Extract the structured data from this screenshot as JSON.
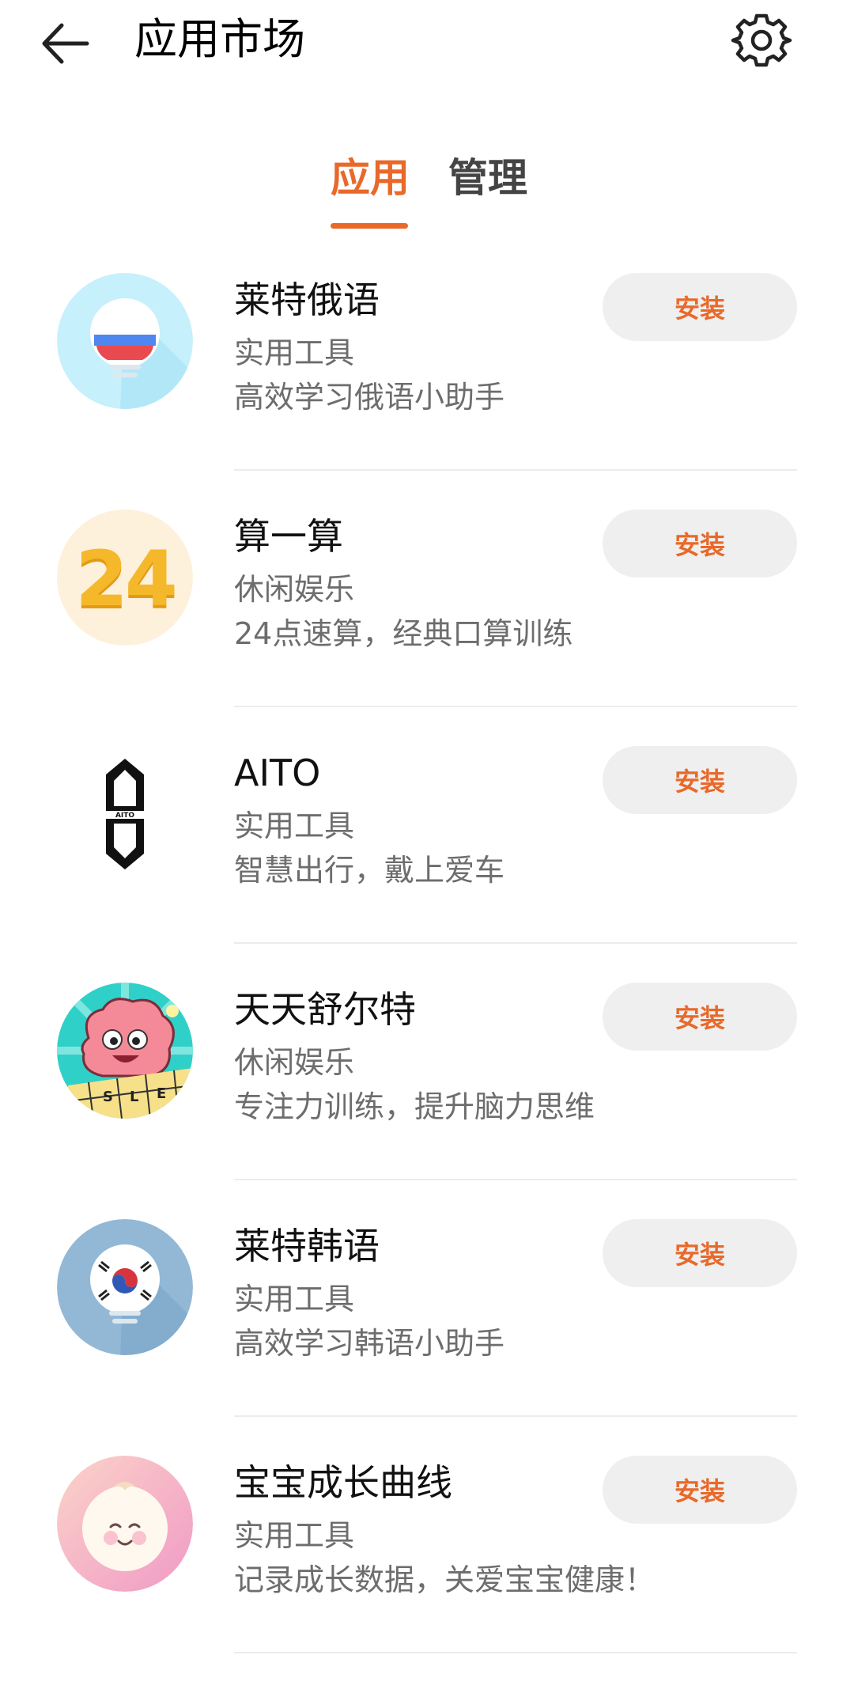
{
  "header": {
    "title": "应用市场",
    "back_icon": "arrow-left-icon",
    "settings_icon": "gear-icon"
  },
  "tabs": [
    {
      "label": "应用",
      "active": true
    },
    {
      "label": "管理",
      "active": false
    }
  ],
  "colors": {
    "accent": "#e8692a",
    "button_bg": "#efefef",
    "secondary_text": "#6d6d6d"
  },
  "apps": [
    {
      "name": "莱特俄语",
      "category": "实用工具",
      "description": "高效学习俄语小助手",
      "button": "安装",
      "icon": "russian-flag-bulb-icon"
    },
    {
      "name": "算一算",
      "category": "休闲娱乐",
      "description": "24点速算，经典口算训练",
      "button": "安装",
      "icon": "number-24-icon",
      "icon_text": "24"
    },
    {
      "name": "AITO",
      "category": "实用工具",
      "description": "智慧出行，戴上爱车",
      "button": "安装",
      "icon": "aito-logo-icon"
    },
    {
      "name": "天天舒尔特",
      "category": "休闲娱乐",
      "description": "专注力训练，提升脑力思维",
      "button": "安装",
      "icon": "cartoon-brain-icon"
    },
    {
      "name": "莱特韩语",
      "category": "实用工具",
      "description": "高效学习韩语小助手",
      "button": "安装",
      "icon": "korean-flag-bulb-icon"
    },
    {
      "name": "宝宝成长曲线",
      "category": "实用工具",
      "description": "记录成长数据，关爱宝宝健康！",
      "button": "安装",
      "icon": "baby-face-icon"
    }
  ]
}
